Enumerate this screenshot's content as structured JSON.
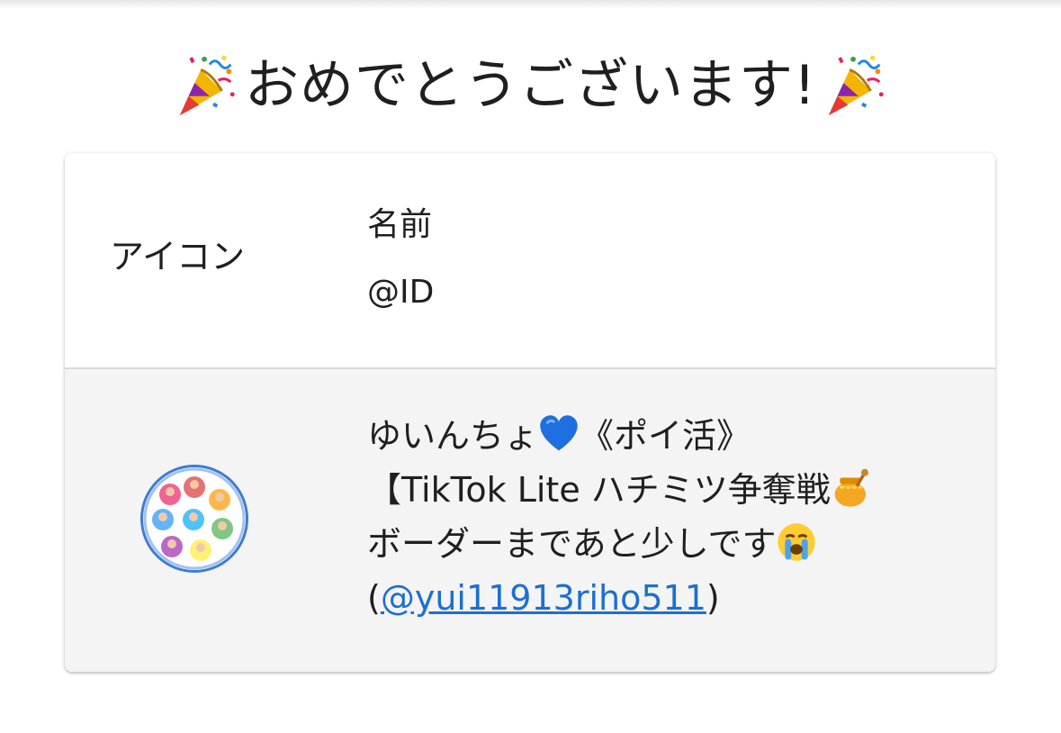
{
  "heading": {
    "text": "おめでとうございます!",
    "left_icon": "party-popper-icon",
    "right_icon": "party-popper-icon"
  },
  "table": {
    "columns": {
      "icon_header": "アイコン",
      "name_header": "名前",
      "id_header": "@ID"
    },
    "entries": [
      {
        "avatar": "circular group photo avatar",
        "line1_text": "ゆいんちょ",
        "line1_emoji": "blue-heart-icon",
        "line1_suffix": "《ポイ活》",
        "line2_text": "【TikTok Lite ハチミツ争奪戦",
        "line2_emoji": "honey-pot-icon",
        "line3_text": "ボーダーまであと少しです",
        "line3_emoji": "loudly-crying-face-icon",
        "handle_open": "(",
        "handle": "@yui11913riho511",
        "handle_close": ")"
      }
    ]
  },
  "colors": {
    "link": "#1d6fd1",
    "row_alt_background": "#f4f4f4",
    "avatar_border": "#3f7bd2"
  }
}
